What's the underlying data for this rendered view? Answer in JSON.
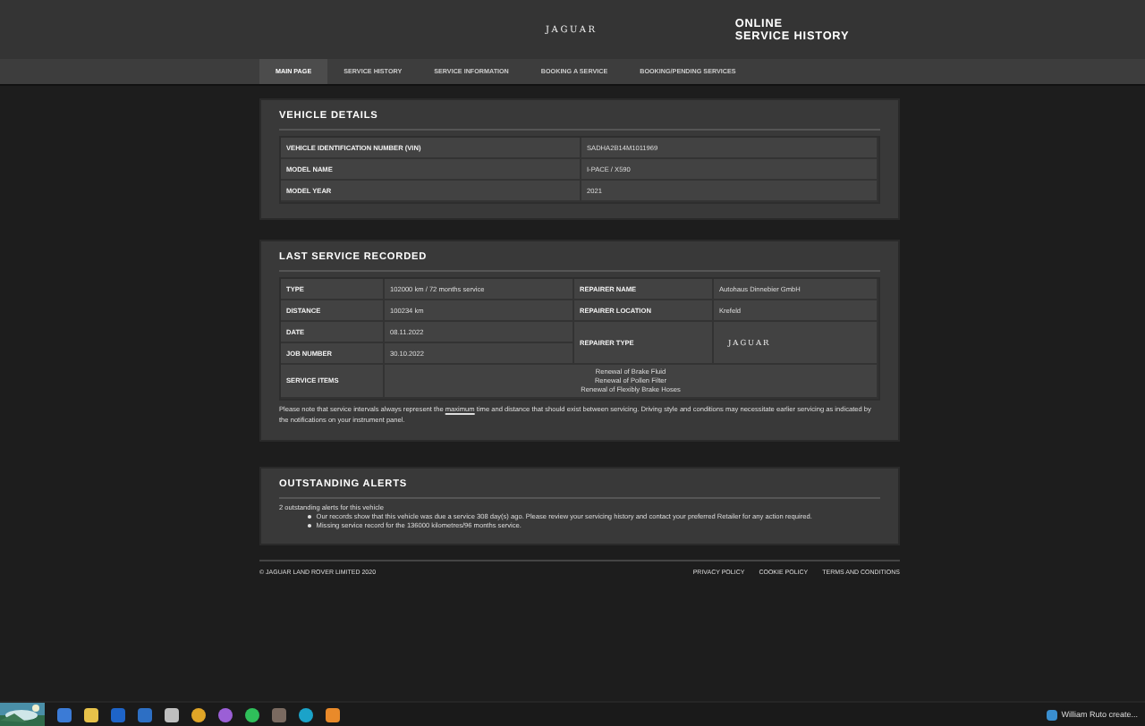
{
  "header": {
    "brand": "JAGUAR",
    "title_lines": [
      "ONLINE",
      "SERVICE HISTORY"
    ]
  },
  "nav": [
    {
      "label": "MAIN PAGE",
      "selected": true
    },
    {
      "label": "SERVICE HISTORY",
      "selected": false
    },
    {
      "label": "SERVICE INFORMATION",
      "selected": false
    },
    {
      "label": "BOOKING A SERVICE",
      "selected": false
    },
    {
      "label": "BOOKING/PENDING SERVICES",
      "selected": false
    }
  ],
  "vehicle_details": {
    "title": "VEHICLE DETAILS",
    "rows": [
      {
        "label": "VEHICLE IDENTIFICATION NUMBER (VIN)",
        "value": "SADHA2B14M1011969"
      },
      {
        "label": "MODEL NAME",
        "value": "I-PACE / X590"
      },
      {
        "label": "MODEL YEAR",
        "value": "2021"
      }
    ]
  },
  "last_service": {
    "title": "LAST SERVICE RECORDED",
    "left_fields": [
      {
        "label": "TYPE",
        "value": "102000 km / 72 months service"
      },
      {
        "label": "DISTANCE",
        "value": "100234 km"
      },
      {
        "label": "DATE",
        "value": "08.11.2022"
      },
      {
        "label": "JOB NUMBER",
        "value": "30.10.2022"
      }
    ],
    "right_fields": [
      {
        "label": "REPAIRER NAME",
        "value": "Autohaus Dinnebier GmbH",
        "kind": "text"
      },
      {
        "label": "REPAIRER LOCATION",
        "value": "Krefeld",
        "kind": "text"
      },
      {
        "label": "REPAIRER TYPE",
        "value": "JAGUAR",
        "kind": "logo"
      }
    ],
    "service_items": {
      "label": "SERVICE ITEMS",
      "items": [
        "Renewal of Brake Fluid",
        "Renewal of Pollen Filter",
        "Renewal of Flexibly Brake Hoses"
      ]
    },
    "note": "Please note that service intervals always represent the **maximum** time and distance that should exist between servicing. Driving style and conditions may necessitate earlier servicing as indicated by the notifications on your instrument panel."
  },
  "alerts": {
    "title": "OUTSTANDING ALERTS",
    "summary": "2 outstanding alerts for this vehicle",
    "items": [
      "Our records show that this vehicle was due a service 308 day(s) ago. Please review your servicing history and contact your preferred Retailer for any action required.",
      "Missing service record for the 136000 kilometres/96 months service."
    ]
  },
  "footer": {
    "copyright": "© JAGUAR LAND ROVER LIMITED 2020",
    "links": [
      "PRIVACY POLICY",
      "COOKIE POLICY",
      "TERMS AND CONDITIONS"
    ]
  },
  "taskbar": {
    "notification": "William Ruto create..."
  }
}
